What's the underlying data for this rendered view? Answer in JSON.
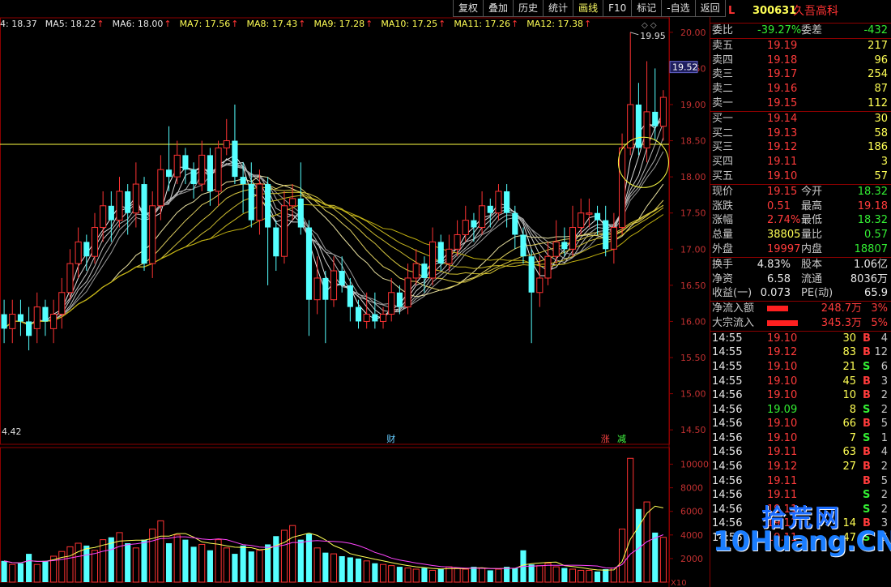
{
  "toolbar": [
    "复权",
    "叠加",
    "历史",
    "统计",
    "画线",
    "F10",
    "标记",
    "-自选",
    "返回"
  ],
  "toolbar_active": 4,
  "ma_legend": [
    {
      "label": "4: 18.37",
      "color": "#e8e8e8",
      "arrow": false
    },
    {
      "label": "MA5: 18.22",
      "color": "#e8e8e8",
      "arrow": true
    },
    {
      "label": "MA6: 18.00",
      "color": "#e8e8e8",
      "arrow": true
    },
    {
      "label": "MA7: 17.56",
      "color": "#ffff55",
      "arrow": true
    },
    {
      "label": "MA8: 17.43",
      "color": "#ffff55",
      "arrow": true
    },
    {
      "label": "MA9: 17.28",
      "color": "#ffff55",
      "arrow": true
    },
    {
      "label": "MA10: 17.25",
      "color": "#ffff55",
      "arrow": true
    },
    {
      "label": "MA11: 17.26",
      "color": "#ffff55",
      "arrow": true
    },
    {
      "label": "MA12: 17.38",
      "color": "#ffff55",
      "arrow": true
    }
  ],
  "diamonds": "◇ ◇",
  "price_axis": [
    "20.00",
    "19.50",
    "19.00",
    "18.50",
    "18.00",
    "17.50",
    "17.00",
    "16.50",
    "16.00",
    "15.50",
    "15.00",
    "14.50"
  ],
  "current_price_label": "19.52",
  "high_label": "19.95",
  "low_label": "4.42",
  "markers": [
    {
      "text": "财",
      "color": "#66ccff"
    },
    {
      "text": "涨",
      "color": "#ff4444"
    },
    {
      "text": "减",
      "color": "#44ff44"
    }
  ],
  "vol_axis": [
    "10000",
    "8000",
    "6000",
    "4000",
    "2000"
  ],
  "vol_unit": "X10",
  "stock": {
    "flag": "L",
    "code": "300631",
    "name": "久吾高科"
  },
  "weibi": {
    "label": "委比",
    "value": "-39.27%",
    "label2": "委差",
    "value2": "-432"
  },
  "asks": [
    {
      "label": "卖五",
      "price": "19.19",
      "vol": "217"
    },
    {
      "label": "卖四",
      "price": "19.18",
      "vol": "96"
    },
    {
      "label": "卖三",
      "price": "19.17",
      "vol": "254"
    },
    {
      "label": "卖二",
      "price": "19.16",
      "vol": "87"
    },
    {
      "label": "卖一",
      "price": "19.15",
      "vol": "112"
    }
  ],
  "bids": [
    {
      "label": "买一",
      "price": "19.14",
      "vol": "30"
    },
    {
      "label": "买二",
      "price": "19.13",
      "vol": "58"
    },
    {
      "label": "买三",
      "price": "19.12",
      "vol": "186"
    },
    {
      "label": "买四",
      "price": "19.11",
      "vol": "3"
    },
    {
      "label": "买五",
      "price": "19.10",
      "vol": "57"
    }
  ],
  "stats1": [
    {
      "l1": "现价",
      "v1": "19.15",
      "c1": "red",
      "l2": "今开",
      "v2": "18.32",
      "c2": "green"
    },
    {
      "l1": "涨跌",
      "v1": "0.51",
      "c1": "red",
      "l2": "最高",
      "v2": "19.18",
      "c2": "red"
    },
    {
      "l1": "涨幅",
      "v1": "2.74%",
      "c1": "red",
      "l2": "最低",
      "v2": "18.32",
      "c2": "green"
    },
    {
      "l1": "总量",
      "v1": "38805",
      "c1": "yellow",
      "l2": "量比",
      "v2": "0.57",
      "c2": "green"
    },
    {
      "l1": "外盘",
      "v1": "19997",
      "c1": "red",
      "l2": "内盘",
      "v2": "18807",
      "c2": "green"
    }
  ],
  "stats2": [
    {
      "l1": "换手",
      "v1": "4.83%",
      "l2": "股本",
      "v2": "1.06亿"
    },
    {
      "l1": "净资",
      "v1": "6.58",
      "l2": "流通",
      "v2": "8036万"
    },
    {
      "l1": "收益(一)",
      "v1": "0.073",
      "l2": "PE(动)",
      "v2": "65.9"
    }
  ],
  "flows": [
    {
      "label": "净流入额",
      "value": "248.7万",
      "pct": "3%",
      "bar": 0.55
    },
    {
      "label": "大宗流入",
      "value": "345.3万",
      "pct": "5%",
      "bar": 0.8
    }
  ],
  "ticks": [
    {
      "t": "14:55",
      "p": "19.10",
      "v": "30",
      "d": "B",
      "n": "4"
    },
    {
      "t": "14:55",
      "p": "19.12",
      "v": "83",
      "d": "B",
      "n": "12"
    },
    {
      "t": "14:55",
      "p": "19.10",
      "v": "21",
      "d": "S",
      "n": "6"
    },
    {
      "t": "14:55",
      "p": "19.10",
      "v": "45",
      "d": "B",
      "n": "3"
    },
    {
      "t": "14:56",
      "p": "19.10",
      "v": "10",
      "d": "B",
      "n": "2"
    },
    {
      "t": "14:56",
      "p": "19.09",
      "v": "8",
      "d": "S",
      "n": "2"
    },
    {
      "t": "14:56",
      "p": "19.10",
      "v": "66",
      "d": "B",
      "n": "5"
    },
    {
      "t": "14:56",
      "p": "19.10",
      "v": "7",
      "d": "S",
      "n": "1"
    },
    {
      "t": "14:56",
      "p": "19.11",
      "v": "63",
      "d": "B",
      "n": "4"
    },
    {
      "t": "14:56",
      "p": "19.12",
      "v": "27",
      "d": "B",
      "n": "2"
    },
    {
      "t": "14:56",
      "p": "19.11",
      "v": "",
      "d": "B",
      "n": "5"
    },
    {
      "t": "14:56",
      "p": "19.11",
      "v": "",
      "d": "S",
      "n": "2"
    },
    {
      "t": "14:56",
      "p": "19.11",
      "v": "",
      "d": "S",
      "n": "2"
    },
    {
      "t": "14:56",
      "p": "19.11",
      "v": "14",
      "d": "B",
      "n": "3"
    },
    {
      "t": "14:56",
      "p": "19.11",
      "v": "47",
      "d": "S",
      "n": "5"
    }
  ],
  "watermark": {
    "cn": "拾荒网",
    "en": "10Huang.CN"
  },
  "chart_data": {
    "type": "candlestick",
    "price_range": [
      14.3,
      20.2
    ],
    "horizontal_line": 18.45,
    "candles": [
      [
        16.1,
        15.9,
        16.3,
        15.7
      ],
      [
        15.9,
        16.1,
        16.3,
        15.7
      ],
      [
        16.1,
        16.0,
        16.3,
        15.8
      ],
      [
        16.0,
        15.8,
        16.2,
        15.6
      ],
      [
        15.9,
        16.2,
        16.4,
        15.7
      ],
      [
        16.2,
        16.0,
        16.3,
        15.8
      ],
      [
        15.9,
        16.1,
        16.3,
        15.7
      ],
      [
        16.1,
        16.4,
        16.6,
        15.9
      ],
      [
        16.4,
        16.8,
        17.0,
        16.3
      ],
      [
        16.8,
        17.1,
        17.3,
        16.6
      ],
      [
        17.1,
        16.9,
        17.2,
        16.7
      ],
      [
        16.9,
        17.3,
        17.5,
        16.8
      ],
      [
        17.3,
        17.6,
        17.8,
        17.1
      ],
      [
        17.6,
        17.4,
        17.8,
        17.1
      ],
      [
        17.4,
        17.8,
        18.0,
        17.3
      ],
      [
        17.8,
        17.5,
        17.9,
        17.2
      ],
      [
        17.5,
        17.9,
        18.2,
        17.3
      ],
      [
        17.9,
        16.8,
        18.0,
        16.7
      ],
      [
        16.8,
        17.6,
        17.8,
        16.6
      ],
      [
        17.6,
        18.1,
        18.3,
        17.4
      ],
      [
        18.1,
        18.0,
        18.7,
        17.8
      ],
      [
        18.0,
        18.3,
        18.5,
        17.9
      ],
      [
        18.3,
        18.1,
        18.4,
        17.9
      ],
      [
        18.1,
        17.9,
        18.2,
        17.7
      ],
      [
        17.9,
        18.3,
        18.5,
        17.8
      ],
      [
        18.3,
        17.8,
        18.4,
        17.6
      ],
      [
        17.8,
        18.4,
        18.5,
        17.6
      ],
      [
        18.4,
        18.5,
        18.8,
        18.3
      ],
      [
        18.5,
        18.0,
        19.0,
        17.9
      ],
      [
        18.0,
        17.9,
        18.2,
        17.5
      ],
      [
        17.9,
        17.4,
        18.2,
        17.3
      ],
      [
        17.4,
        17.9,
        18.1,
        17.2
      ],
      [
        17.9,
        17.3,
        18.0,
        16.5
      ],
      [
        17.3,
        16.9,
        17.4,
        16.7
      ],
      [
        16.9,
        17.6,
        17.8,
        16.8
      ],
      [
        17.6,
        17.7,
        17.9,
        17.4
      ],
      [
        17.7,
        17.3,
        18.2,
        17.2
      ],
      [
        17.3,
        16.3,
        17.4,
        15.8
      ],
      [
        16.3,
        16.6,
        16.9,
        16.1
      ],
      [
        16.6,
        16.3,
        16.7,
        15.7
      ],
      [
        16.3,
        16.7,
        16.9,
        16.2
      ],
      [
        16.7,
        16.5,
        16.9,
        16.4
      ],
      [
        16.5,
        16.2,
        16.6,
        16.0
      ],
      [
        16.2,
        16.0,
        16.3,
        15.9
      ],
      [
        16.0,
        16.1,
        16.4,
        15.9
      ],
      [
        16.1,
        16.0,
        16.4,
        15.9
      ],
      [
        16.0,
        16.1,
        16.2,
        15.9
      ],
      [
        16.1,
        16.4,
        16.6,
        16.0
      ],
      [
        16.4,
        16.2,
        16.5,
        16.1
      ],
      [
        16.2,
        16.6,
        16.8,
        16.1
      ],
      [
        16.6,
        16.8,
        17.0,
        16.5
      ],
      [
        16.8,
        16.6,
        16.9,
        16.4
      ],
      [
        16.6,
        17.1,
        17.3,
        16.5
      ],
      [
        17.1,
        16.8,
        17.2,
        16.7
      ],
      [
        16.8,
        17.0,
        17.2,
        16.7
      ],
      [
        17.0,
        17.2,
        17.4,
        16.9
      ],
      [
        17.2,
        17.4,
        17.6,
        17.1
      ],
      [
        17.4,
        17.3,
        17.5,
        17.1
      ],
      [
        17.3,
        17.6,
        17.8,
        17.2
      ],
      [
        17.6,
        17.5,
        17.7,
        17.3
      ],
      [
        17.5,
        17.8,
        17.9,
        17.4
      ],
      [
        17.8,
        17.5,
        17.9,
        17.3
      ],
      [
        17.5,
        17.2,
        17.6,
        17.0
      ],
      [
        17.2,
        16.9,
        17.3,
        16.8
      ],
      [
        16.9,
        16.4,
        17.0,
        15.7
      ],
      [
        16.4,
        16.6,
        16.9,
        16.2
      ],
      [
        16.6,
        16.9,
        17.1,
        16.5
      ],
      [
        16.9,
        17.1,
        17.4,
        16.8
      ],
      [
        17.1,
        17.0,
        17.3,
        16.9
      ],
      [
        17.0,
        17.3,
        17.6,
        16.9
      ],
      [
        17.3,
        17.5,
        17.7,
        17.2
      ],
      [
        17.5,
        17.5,
        17.7,
        17.3
      ],
      [
        17.5,
        17.4,
        17.6,
        17.2
      ],
      [
        17.4,
        17.0,
        17.6,
        16.9
      ],
      [
        17.0,
        17.3,
        17.5,
        16.8
      ],
      [
        17.3,
        18.4,
        18.6,
        17.2
      ],
      [
        18.4,
        19.0,
        20.0,
        18.3
      ],
      [
        19.0,
        18.4,
        19.3,
        18.3
      ],
      [
        18.4,
        18.9,
        19.6,
        18.2
      ],
      [
        18.9,
        18.7,
        19.5,
        18.5
      ],
      [
        18.7,
        19.1,
        19.2,
        18.5
      ]
    ],
    "volumes": [
      1800,
      1500,
      1600,
      2400,
      1500,
      1800,
      2200,
      2600,
      3000,
      3300,
      3100,
      2700,
      3600,
      3800,
      4200,
      3300,
      2900,
      3600,
      4500,
      5200,
      3300,
      4000,
      3600,
      3000,
      3200,
      2700,
      3600,
      2900,
      2400,
      3100,
      2600,
      2700,
      3200,
      3900,
      4400,
      4800,
      3600,
      4100,
      2900,
      2500,
      2400,
      2200,
      2100,
      2000,
      1800,
      1600,
      1500,
      1400,
      1300,
      1200,
      1100,
      1200,
      1000,
      1100,
      1300,
      1200,
      1100,
      1300,
      1200,
      1000,
      1100,
      1300,
      1200,
      2700,
      1500,
      1400,
      1600,
      1300,
      1200,
      1100,
      1000,
      1000,
      900,
      1100,
      1200,
      4500,
      10500,
      6200,
      6800,
      4200,
      3800
    ]
  }
}
